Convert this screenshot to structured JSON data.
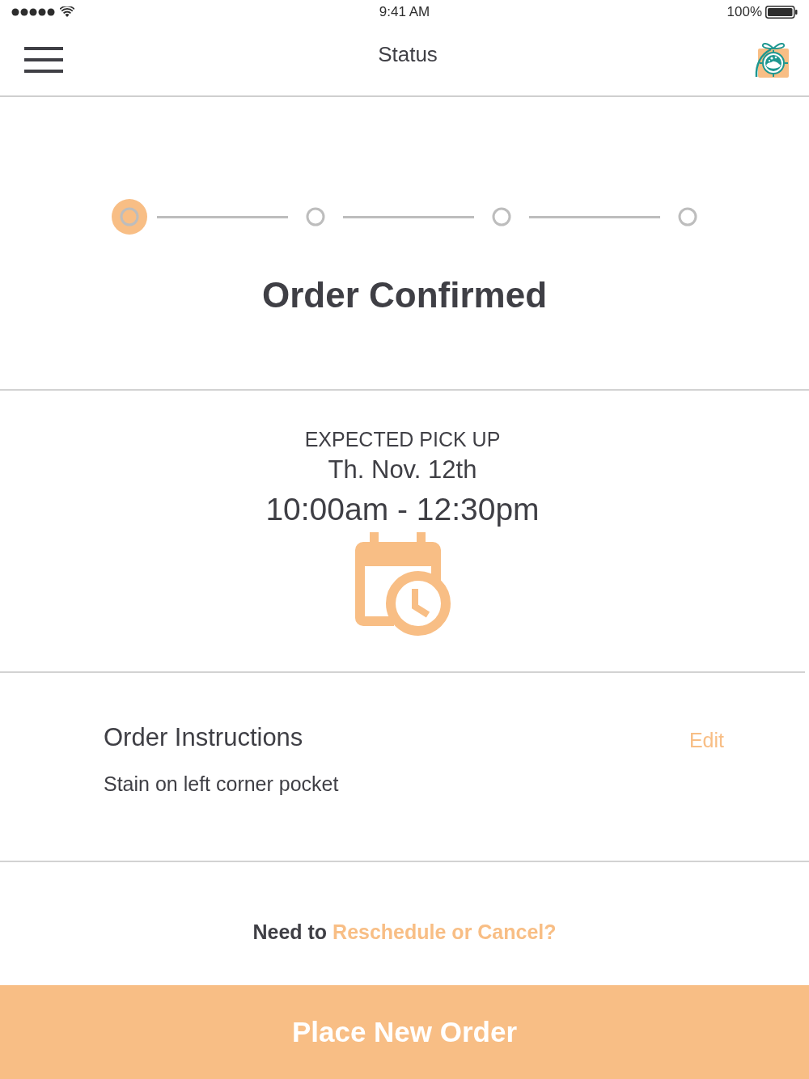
{
  "status_bar": {
    "time": "9:41 AM",
    "battery": "100%"
  },
  "nav": {
    "title": "Status"
  },
  "steps": [
    {
      "current": true
    },
    {
      "current": false
    },
    {
      "current": false
    },
    {
      "current": false
    }
  ],
  "status_title": "Order Confirmed",
  "pickup": {
    "label": "EXPECTED PICK UP",
    "date": "Th. Nov. 12th",
    "time": "10:00am - 12:30pm"
  },
  "instructions": {
    "title": "Order Instructions",
    "edit": "Edit",
    "text": "Stain on left corner pocket"
  },
  "reschedule": {
    "prompt": "Need to",
    "link": "Reschedule or Cancel?"
  },
  "primary_button": "Place New Order"
}
